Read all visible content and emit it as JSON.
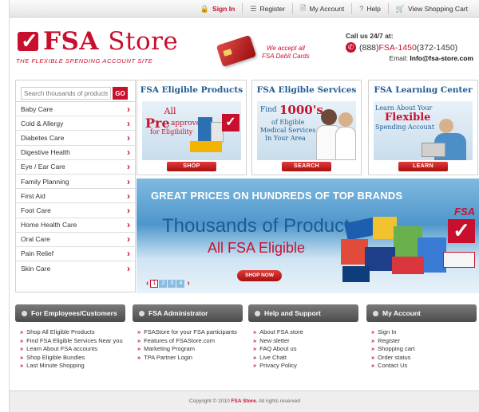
{
  "topnav": {
    "signin": "Sign In",
    "register": "Register",
    "account": "My Account",
    "help": "Help",
    "cart": "View Shopping Cart"
  },
  "header": {
    "logo_fsa": "FSA",
    "logo_store": "Store",
    "tagline": "THE FLEXIBLE SPENDING ACCOUNT SITE",
    "debit_line1": "We accept all",
    "debit_line2": "FSA Debit Cards",
    "call": "Call us  24/7 at:",
    "phone_pre": "(888) ",
    "phone_red": "FSA-1450",
    "phone_post": " (372-1450)",
    "email_label": "Email: ",
    "email": "Info@fsa-store.com"
  },
  "search": {
    "placeholder": "Search thousands of products",
    "button": "GO"
  },
  "categories": [
    "Baby Care",
    "Cold & Allergy",
    "Diabetes Care",
    "Digestive Health",
    "Eye / Ear Care",
    "Family Planning",
    "First Aid",
    "Foot Care",
    "Home Health Care",
    "Oral Care",
    "Pain Relief",
    "Skin Care"
  ],
  "promos": {
    "products": {
      "title": "FSA Eligible Products",
      "all": "All",
      "pre": "Pre",
      "approved": "approved",
      "for": "for Eligibility",
      "button": "SHOP"
    },
    "services": {
      "title": "FSA Eligible Services",
      "find": "Find",
      "num": "1000's",
      "of": "of Eligible",
      "med": "Medical Services",
      "area": "In Your Area",
      "button": "SEARCH"
    },
    "learning": {
      "title": "FSA Learning Center",
      "learn": "Learn About Your",
      "flex": "Flexible",
      "spend": "Spending Account",
      "button": "LEARN"
    }
  },
  "banner": {
    "headline": "GREAT PRICES ON HUNDREDS OF TOP BRANDS",
    "line1": "Thousands of Products",
    "line2": "All FSA Eligible",
    "button": "SHOP NOW",
    "pages": [
      "1",
      "2",
      "3",
      "4"
    ],
    "badge": "FSA"
  },
  "footer": [
    {
      "title": "For Employees/Customers",
      "links": [
        "Shop All Eligible Products",
        "Find FSA Eligible Services Near you",
        "Learn About FSA accounts",
        "Shop Eligible Bundles",
        "Last Minute Shopping"
      ]
    },
    {
      "title": "FSA Administrator",
      "links": [
        "FSAStore for your FSA participants",
        "Features of FSAStore.com",
        "Marketing Program",
        "TPA Partner Login"
      ]
    },
    {
      "title": "Help and Support",
      "links": [
        "About FSA store",
        "New sletter",
        "FAQ About us",
        "Live Chatt",
        "Privacy Policy"
      ]
    },
    {
      "title": "My Account",
      "links": [
        "Sign In",
        "Register",
        "Shopping cart",
        "Order status",
        "Contact Us"
      ]
    }
  ],
  "copyright": {
    "pre": "Copyright © 2010 ",
    "brand": "FSA Store",
    "post": ", All rights reserved"
  },
  "colors": {
    "brand_red": "#c8102e",
    "heading_blue": "#1f5b93"
  }
}
